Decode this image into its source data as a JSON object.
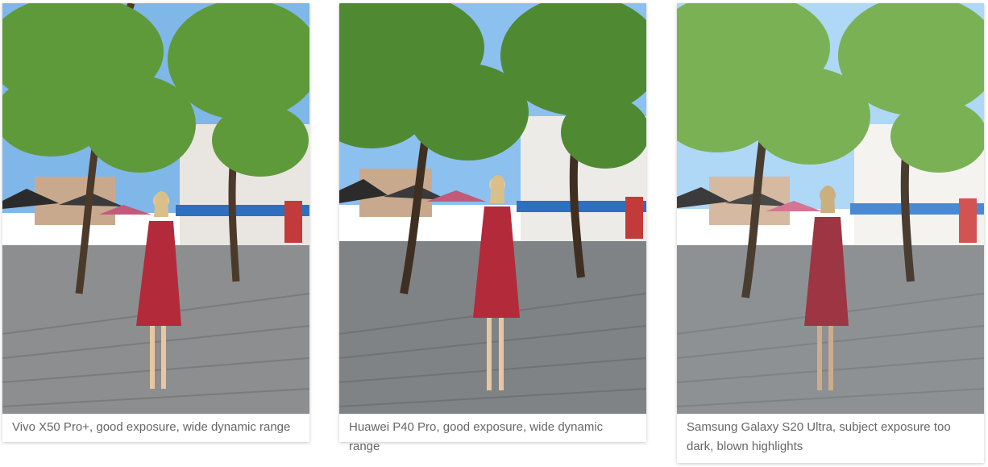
{
  "gallery": {
    "items": [
      {
        "caption": "Vivo X50 Pro+, good exposure, wide dynamic range",
        "sky": "#7fb7e8",
        "foliage": "#5f9a3a",
        "ground": "#8d8e8f",
        "tint": "rgba(255,255,255,0)"
      },
      {
        "caption": "Huawei P40 Pro, good exposure, wide dynamic range",
        "sky": "#8cc0ee",
        "foliage": "#4f8a33",
        "ground": "#7f8386",
        "tint": "rgba(255,255,255,0)"
      },
      {
        "caption": "Samsung Galaxy S20 Ultra, subject exposure too dark, blown highlights",
        "sky": "#a9d4f6",
        "foliage": "#6fab47",
        "ground": "#85888b",
        "tint": "rgba(255,255,255,0.08)"
      }
    ]
  }
}
